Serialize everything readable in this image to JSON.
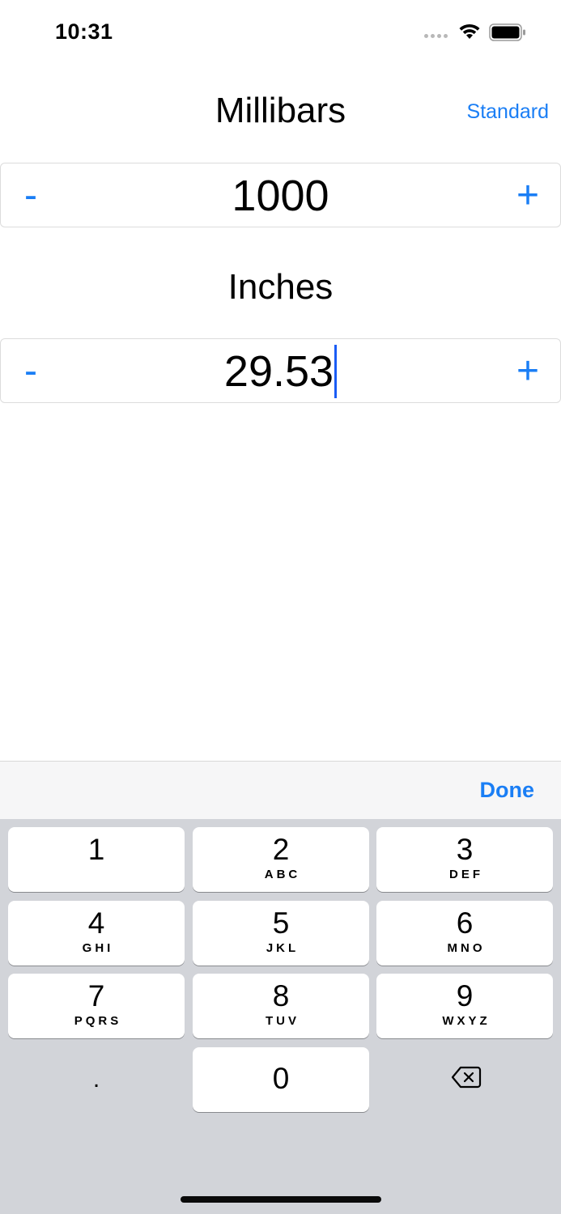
{
  "status_bar": {
    "time": "10:31"
  },
  "converter": {
    "millibars": {
      "title": "Millibars",
      "value": "1000",
      "minus": "-",
      "plus": "+"
    },
    "inches": {
      "title": "Inches",
      "value": "29.53",
      "minus": "-",
      "plus": "+"
    },
    "standard_label": "Standard"
  },
  "keyboard": {
    "done_label": "Done",
    "keys": [
      {
        "digit": "1",
        "letters": ""
      },
      {
        "digit": "2",
        "letters": "ABC"
      },
      {
        "digit": "3",
        "letters": "DEF"
      },
      {
        "digit": "4",
        "letters": "GHI"
      },
      {
        "digit": "5",
        "letters": "JKL"
      },
      {
        "digit": "6",
        "letters": "MNO"
      },
      {
        "digit": "7",
        "letters": "PQRS"
      },
      {
        "digit": "8",
        "letters": "TUV"
      },
      {
        "digit": "9",
        "letters": "WXYZ"
      },
      {
        "digit": "0",
        "letters": ""
      }
    ],
    "decimal_label": ".",
    "backspace_icon": "backspace-icon"
  },
  "colors": {
    "accent": "#1a7ef5",
    "keyboard_bg": "#d2d4d9",
    "caret": "#1a5cf5"
  }
}
